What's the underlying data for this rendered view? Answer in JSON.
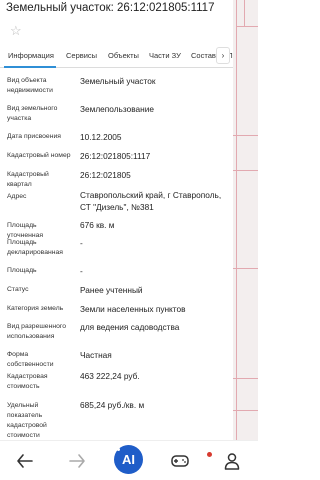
{
  "header": {
    "title": "Земельный участок: 26:12:021805:1117"
  },
  "tabs": [
    {
      "label": "Информация"
    },
    {
      "label": "Сервисы"
    },
    {
      "label": "Объекты"
    },
    {
      "label": "Части ЗУ"
    },
    {
      "label": "Состав ЕЗП"
    }
  ],
  "tab_arrow": "›",
  "rows": [
    {
      "label": "Вид объекта недвижимости",
      "value": "Земельный участок"
    },
    {
      "label": "Вид земельного участка",
      "value": "Землепользование"
    },
    {
      "label": "Дата присвоения",
      "value": "10.12.2005"
    },
    {
      "label": "Кадастровый номер",
      "value": "26:12:021805:1117"
    },
    {
      "label": "Кадастровый квартал",
      "value": "26:12:021805"
    },
    {
      "label": "Адрес",
      "value": "Ставропольский край, г Ставрополь, СТ \"Дизель\", №381"
    },
    {
      "label": "Площадь уточненная",
      "value": "676 кв. м"
    },
    {
      "label": "Площадь декларированная",
      "value": "-"
    },
    {
      "label": "Площадь",
      "value": "-"
    },
    {
      "label": "Статус",
      "value": "Ранее учтенный"
    },
    {
      "label": "Категория земель",
      "value": "Земли населенных пунктов"
    },
    {
      "label": "Вид разрешенного использования",
      "value": "для ведения садоводства"
    },
    {
      "label": "Форма собственности",
      "value": "Частная"
    },
    {
      "label": "Кадастровая стоимость",
      "value": "463 222,24 руб."
    },
    {
      "label": "Удельный показатель кадастровой стоимости",
      "value": "685,24 руб./кв. м"
    }
  ],
  "nav": {
    "ai_label": "AI"
  },
  "colors": {
    "accent": "#2f8fd6",
    "ai_button": "#1f5dc8",
    "notification": "#d73a2f",
    "map_lines": "#e2a9b0"
  }
}
